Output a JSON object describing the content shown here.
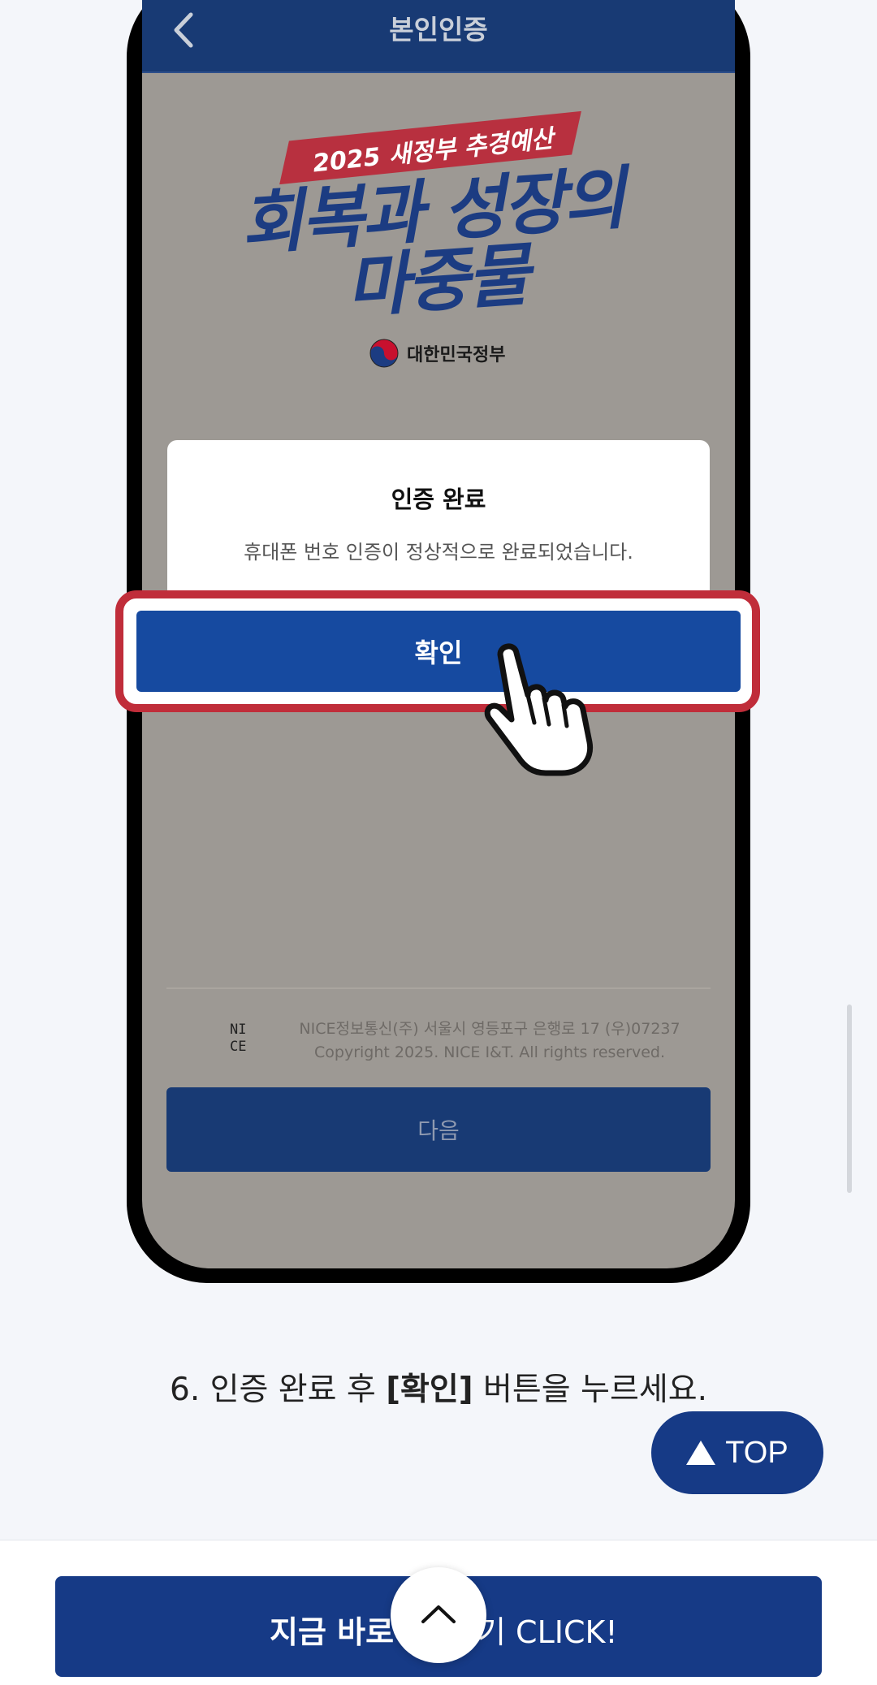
{
  "screen": {
    "title": "본인인증",
    "logo": {
      "banner": "2025 새정부 추경예산",
      "headline_line1": "회복과 성장의",
      "headline_line2": "마중물",
      "gov_label": "대한민국정부"
    },
    "modal": {
      "title": "인증 완료",
      "message": "휴대폰 번호 인증이 정상적으로 완료되었습니다.",
      "confirm_label": "확인"
    },
    "footer": {
      "nice_logo_line1": "NI",
      "nice_logo_line2": "CE",
      "address": "NICE정보통신(주) 서울시 영등포구 은행로 17 (우)07237",
      "copyright": "Copyright 2025. NICE I&T. All rights reserved.",
      "next_label": "다음"
    }
  },
  "caption": {
    "prefix": "6. 인증 완료 후 ",
    "bold": "[확인]",
    "suffix": " 버튼을 누르세요."
  },
  "top_button": {
    "label": "TOP"
  },
  "cta": {
    "label": "지금 바로 신청하기 CLICK!",
    "visible_left": "지금 바로",
    "visible_right": "기 CLICK!"
  },
  "colors": {
    "brand_navy": "#163a86",
    "header_navy": "#183a74",
    "confirm_blue": "#164aa0",
    "highlight_red": "#c02d3a"
  },
  "icons": [
    "chevron-left-icon",
    "taegeuk-icon",
    "pointing-hand-icon",
    "triangle-up-icon",
    "chevron-up-icon"
  ]
}
